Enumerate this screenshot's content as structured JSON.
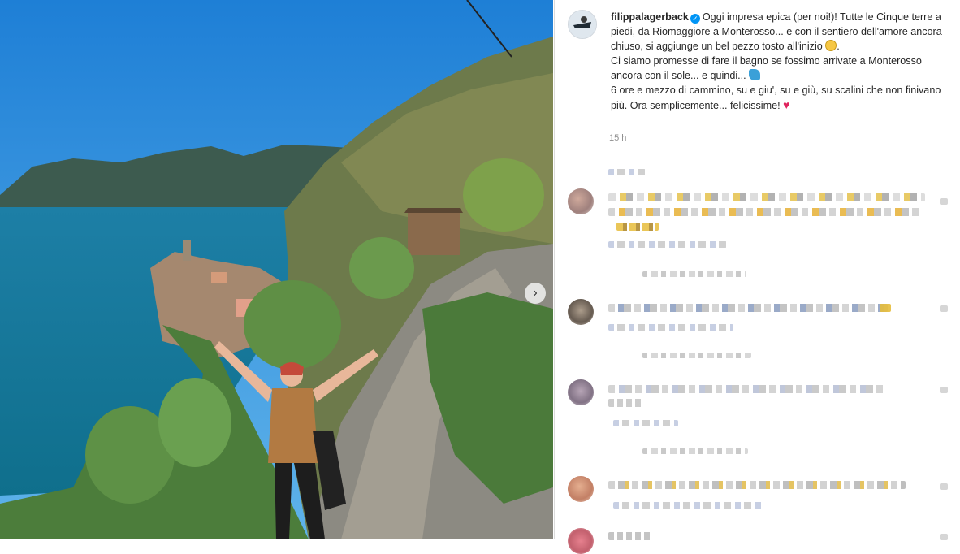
{
  "post": {
    "username": "filippalagerback",
    "caption_line1": "Oggi impresa epica (per noi!)! Tutte le Cinque terre a piedi, da Riomaggiore a Monterosso... e con il sentiero dell'amore ancora chiuso, si aggiunge un bel pezzo tosto all'inizio",
    "caption_line2": "Ci siamo promesse di fare il bagno se fossimo arrivate a Monterosso ancora con il sole... e quindi...",
    "caption_line3": "6 ore e mezzo di cammino, su e giu', su e giù, su scalini che non finivano più. Ora semplicemente... felicissime!",
    "timestamp": "15 h",
    "icons": {
      "verified": "verified-badge-icon",
      "emoji1": "grinning-sweat-emoji",
      "emoji2": "water-wave-emoji",
      "emoji3": "red-heart-emoji",
      "next": "chevron-right-icon"
    },
    "colors": {
      "accent": "#0095f6",
      "text": "#262626",
      "muted": "#8e8e8e"
    }
  }
}
